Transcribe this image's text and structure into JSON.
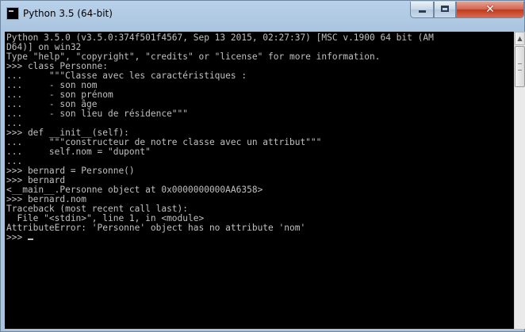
{
  "window": {
    "title": "Python 3.5 (64-bit)",
    "controls": {
      "minimize": "minimize",
      "maximize": "maximize",
      "close": "close"
    }
  },
  "icons": {
    "app": "python-console-icon",
    "up": "scroll-up-arrow-icon"
  },
  "console": {
    "lines": [
      "Python 3.5.0 (v3.5.0:374f501f4567, Sep 13 2015, 02:27:37) [MSC v.1900 64 bit (AM",
      "D64)] on win32",
      "Type \"help\", \"copyright\", \"credits\" or \"license\" for more information.",
      ">>> class Personne:",
      "...     \"\"\"Classe avec les caractéristiques :",
      "...     - son nom",
      "...     - son prénom",
      "...     - son âge",
      "...     - son lieu de résidence\"\"\"",
      "...",
      ">>> def __init__(self):",
      "...     \"\"\"constructeur de notre classe avec un attribut\"\"\"",
      "...     self.nom = \"dupont\"",
      "...",
      ">>> bernard = Personne()",
      ">>> bernard",
      "<__main__.Personne object at 0x0000000000AA6358>",
      ">>> bernard.nom",
      "Traceback (most recent call last):",
      "  File \"<stdin>\", line 1, in <module>",
      "AttributeError: 'Personne' object has no attribute 'nom'",
      ">>> "
    ]
  },
  "colors": {
    "console_bg": "#000000",
    "console_fg": "#c0c0c0",
    "close_button": "#c7432b",
    "frame": "#aac4de"
  }
}
